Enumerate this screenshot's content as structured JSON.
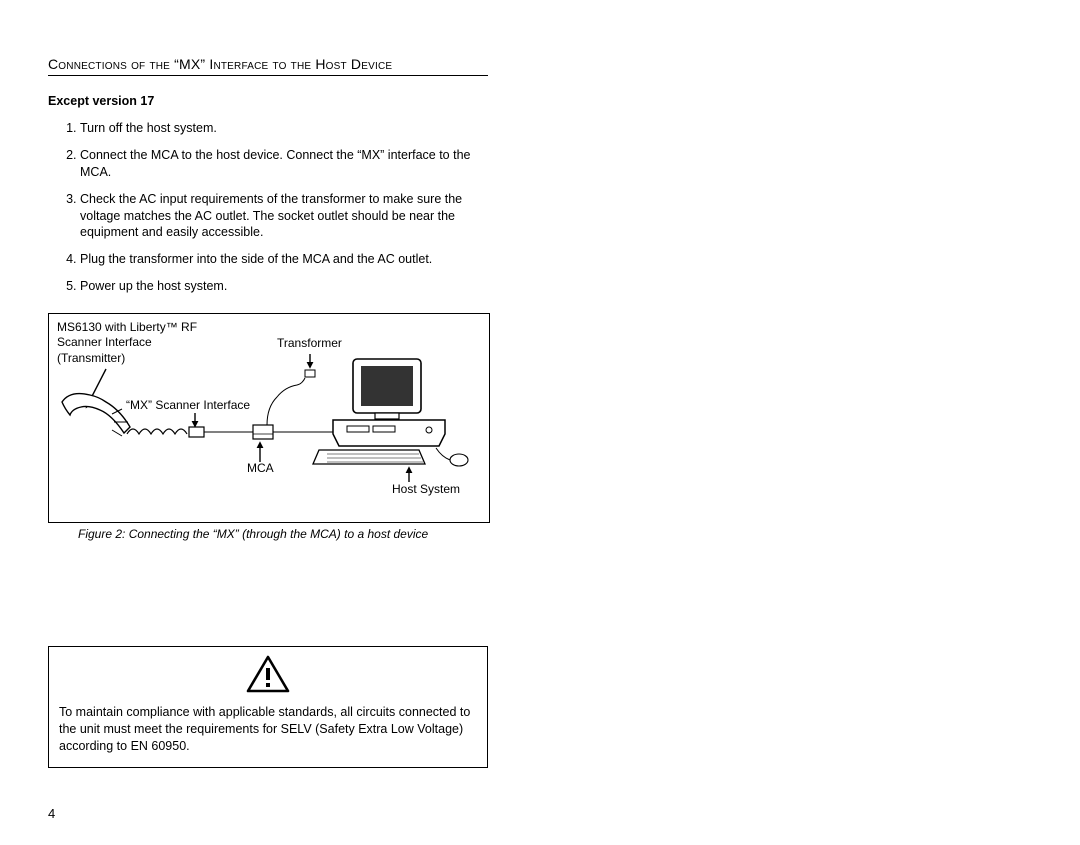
{
  "title": "Connections of the “MX” Interface to the Host Device",
  "subheading": "Except version 17",
  "steps": [
    "Turn off the host system.",
    "Connect the MCA to the host device. Connect the “MX” interface to the MCA.",
    "Check the AC input requirements of the transformer to make sure the voltage matches the AC outlet.  The socket outlet should be near the equipment and easily accessible.",
    "Plug the transformer into the side of the MCA and the AC outlet.",
    "Power up the host system."
  ],
  "figure": {
    "label_scanner": "MS6130 with Liberty™ RF\nScanner Interface\n(Transmitter)",
    "label_mx": "“MX” Scanner Interface",
    "label_transformer": "Transformer",
    "label_mca": "MCA",
    "label_host": "Host System",
    "caption": "Figure 2:  Connecting the “MX” (through the MCA)  to a  host device"
  },
  "warning": "To maintain compliance with applicable standards, all circuits connected to the unit must meet the requirements for SELV (Safety Extra Low Voltage) according to EN 60950.",
  "page_number": "4"
}
